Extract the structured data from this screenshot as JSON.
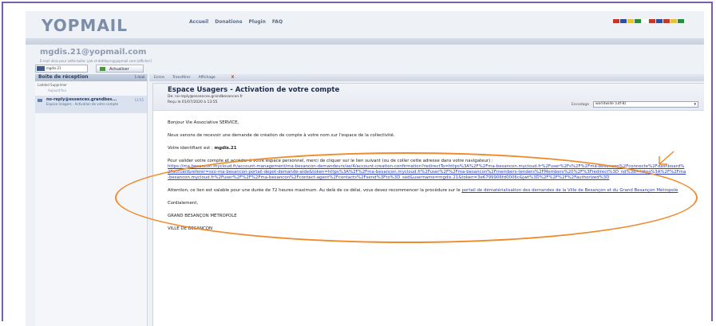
{
  "header": {
    "logo": "YOPMAIL",
    "nav": [
      "Accueil",
      "Donations",
      "Plugin",
      "FAQ"
    ],
    "flag_colors": [
      "#c0392b",
      "#2d4f9e",
      "#e2c33a",
      "#2b8a3e",
      "#ffffff",
      "#c0392b",
      "#2d4f9e",
      "#c0392b",
      "#e2c33a",
      "#2b8a3e"
    ]
  },
  "mailbox": {
    "title": "mgdis.21@yopmail.com",
    "subtitle": "E-mail alias pour cette boite: yah.ct-dahlbyrn@yopmail.com [afficher]",
    "inbox_value": "mgdis.21",
    "refresh_label": "Actualiser"
  },
  "inbox": {
    "title": "Boite de réception",
    "count_label": "1 mail",
    "tools_label": "Ladded  Supprimer",
    "today_label": "Aujourd'hui",
    "messages": [
      {
        "from": "no-reply@essences.grandbes...",
        "subject": "Espace Usagers - Activation de votre compte",
        "time": "13:55"
      }
    ]
  },
  "toolbar": {
    "items": [
      "Ecrire",
      "Transférer",
      "Affichage",
      "",
      "X"
    ]
  },
  "message": {
    "subject": "Espace Usagers - Activation de votre compte",
    "from_line": "De: no-reply@essences.grandbesancon.fr",
    "date_line": "Reçu le 01/07/2020 à 13:55",
    "encoding_label": "Encodage",
    "encoding_value": "worldwide (utf-8)",
    "greeting": "Bonjour Vie Associative SERVICE,",
    "p1": "Nous venons de recevoir une demande de création de compte à votre nom sur l'espace de la collectivité.",
    "p2_prefix": "Votre identifiant est : ",
    "identifier": "mgdis.21",
    "p3": "Pour valider votre compte et accéder à votre espace personnel, merci de cliquer sur le lien suivant (ou de coller cette adresse dans votre navigateur) :",
    "link": "https://ma.besancon.mycloud.fr/account-management/ma-besancon-demandeurs/se/4/account-creation-confirmation?redirectTo=https%3A%2F%2Fma-besancon.mycloud.fr%2Fuser%2Fs%2F%2Fma-besancon%2Fconnecte%2Fdashboard%2Faccueil&referer=sso-ma-besancon-portail-depot-demande-aide&token=https%3A%2F%2Fma-besancon.mycloud.fr%2Fuser%2F%2Fma-besancon%2Fmembers-tenders%2FMembers%20%2F%3Fredirect%3D_nd%3B=https%3A%2F%2Fma-besancon.mycloud.fr%2Fuser%2F%2F%2Fma-besancon%2Fcontact-agent%2Fcontacts%2Fsend%3Fto%3D_sed&username=mgdis.21&token=3e6799906fd0006c&jwt%3D%2F%2F%2F%2Fauthorized%3D",
    "p4_prefix": "Attention, ce lien est valable pour une durée de 72 heures maximum. Au delà de ce délai, vous devez recommencer la procédure sur le ",
    "p4_link": "portail de dématérialisation des demandes de la Ville de Besançon et du Grand Besançon Métropole",
    "closing": "Cordialement,",
    "sign1": "GRAND BESANÇON MÉTROPOLE",
    "sign2": "VILLE DE BESANÇON"
  },
  "annotation": {
    "color": "#f08a2a"
  }
}
